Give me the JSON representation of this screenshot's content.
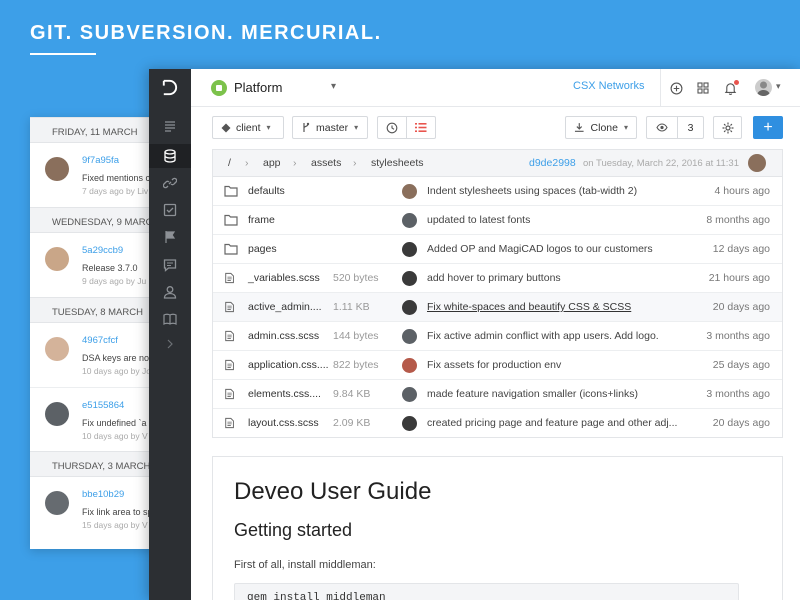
{
  "headline": "GIT. SUBVERSION. MERCURIAL.",
  "activity": [
    {
      "day": "FRIDAY, 11 MARCH",
      "hash": "9f7a95fa",
      "message": "Fixed mentions c",
      "meta": "7 days ago by Liv",
      "avatar_color": "#8a6f5c"
    },
    {
      "day": "WEDNESDAY, 9 MARCH",
      "hash": "5a29ccb9",
      "message": "Release 3.7.0",
      "meta": "9 days ago by Ju",
      "avatar_color": "#c9a688"
    },
    {
      "day": "TUESDAY, 8 MARCH",
      "hash": "4967cfcf",
      "message": "DSA keys are no",
      "meta": "10 days ago by Jo",
      "avatar_color": "#d4b39a"
    },
    {
      "day": "",
      "hash": "e5155864",
      "message": "Fix undefined `a",
      "meta": "10 days ago by V",
      "avatar_color": "#5c6166"
    },
    {
      "day": "THURSDAY, 3 MARCH",
      "hash": "bbe10b29",
      "message": "Fix link area to sp",
      "meta": "15 days ago by V",
      "avatar_color": "#666b70"
    }
  ],
  "topbar": {
    "project": "Platform",
    "organization": "CSX Networks"
  },
  "toolbar": {
    "repo_button": "client",
    "branch_button": "master",
    "clone_button": "Clone",
    "watchers": "3",
    "add_label": "+"
  },
  "breadcrumb": {
    "root": "/",
    "parts": [
      "app",
      "assets",
      "stylesheets"
    ],
    "commit_hash": "d9de2998",
    "commit_date": "on Tuesday, March 22, 2016 at 11:31"
  },
  "files": [
    {
      "type": "folder",
      "name": "defaults",
      "size": "",
      "message": "Indent stylesheets using spaces (tab-width 2)",
      "age": "4 hours ago",
      "avatar_color": "#8a6f5c"
    },
    {
      "type": "folder",
      "name": "frame",
      "size": "",
      "message": "updated to latest fonts",
      "age": "8 months ago",
      "avatar_color": "#5c6166"
    },
    {
      "type": "folder",
      "name": "pages",
      "size": "",
      "message": "Added OP and MagiCAD logos to our customers",
      "age": "12 days ago",
      "avatar_color": "#3a3a3a"
    },
    {
      "type": "file",
      "name": "_variables.scss",
      "size": "520 bytes",
      "message": "add hover to primary buttons",
      "age": "21 hours ago",
      "avatar_color": "#3a3a3a"
    },
    {
      "type": "file",
      "name": "active_admin....",
      "size": "1.11 KB",
      "message": "Fix white-spaces and beautify CSS & SCSS",
      "age": "20 days ago",
      "avatar_color": "#3a3a3a",
      "highlight": true
    },
    {
      "type": "file",
      "name": "admin.css.scss",
      "size": "144 bytes",
      "message": "Fix active admin conflict with app users. Add logo.",
      "age": "3 months ago",
      "avatar_color": "#5c6166"
    },
    {
      "type": "file",
      "name": "application.css....",
      "size": "822 bytes",
      "message": "Fix assets for production env",
      "age": "25 days ago",
      "avatar_color": "#b55a4a"
    },
    {
      "type": "file",
      "name": "elements.css....",
      "size": "9.84 KB",
      "message": "made feature navigation smaller (icons+links)",
      "age": "3 months ago",
      "avatar_color": "#5c6166"
    },
    {
      "type": "file",
      "name": "layout.css.scss",
      "size": "2.09 KB",
      "message": "created pricing page and feature page and other adj...",
      "age": "20 days ago",
      "avatar_color": "#3a3a3a"
    }
  ],
  "readme": {
    "title": "Deveo User Guide",
    "subtitle": "Getting started",
    "intro": "First of all, install middleman:",
    "code": "gem install middleman"
  },
  "colors": {
    "background": "#3d9fe8",
    "accent": "#2f8fe0",
    "sidebar": "#2c2f33"
  }
}
